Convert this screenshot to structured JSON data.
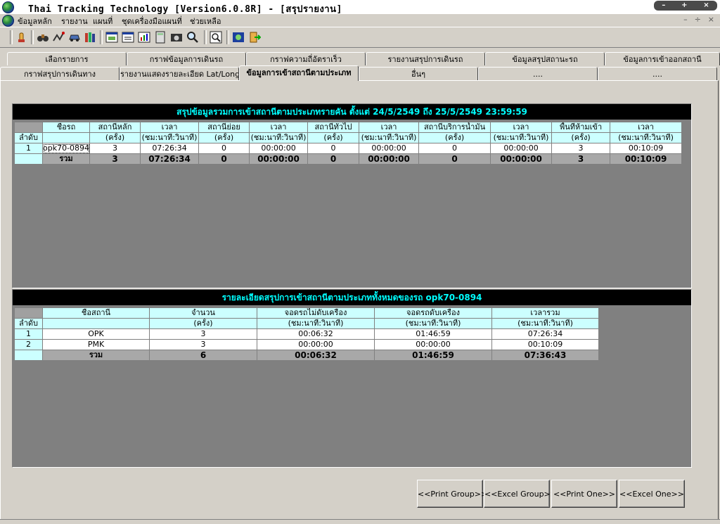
{
  "window": {
    "title": "Thai Tracking Technology [Version6.0.8R] - [สรุปรายงาน]"
  },
  "menu": {
    "items": [
      "ข้อมูลหลัก",
      "รายงาน",
      "แผนที่",
      "ชุดเครื่องมือแผนที่",
      "ช่วยเหลือ"
    ],
    "mdi_controls": [
      "–",
      "÷",
      "×"
    ]
  },
  "toolbar": {
    "icons": [
      "hand-icon",
      "binoculars-icon",
      "route-icon",
      "vehicle-icon",
      "books-icon",
      "map-window-icon",
      "list-window-icon",
      "chart-icon",
      "calculator-icon",
      "camera-icon",
      "search-icon",
      "zoom-icon",
      "export-icon",
      "exit-icon"
    ]
  },
  "tabs": {
    "row1": [
      "เลือกรายการ",
      "กราฟข้อมูลการเดินรถ",
      "กราฟความถี่อัตราเร็ว",
      "รายงานสรุปการเดินรถ",
      "ข้อมูลสรุปสถานะรถ",
      "ข้อมูลการเข้าออกสถานี"
    ],
    "row2": [
      "กราฟสรุปการเดินทาง",
      "รายงานแสดงรายละเอียด Lat/Long",
      "ข้อมูลการเข้าสถานีตามประเภท",
      "อื่นๆ",
      "....",
      "...."
    ],
    "active_index": 2
  },
  "summary": {
    "title": "สรุปข้อมูลรวมการเข้าสถานีตามประเภทรายคัน ตั้งแต่ 24/5/2549  ถึง  25/5/2549 23:59:59",
    "header_row1": [
      "ชื่อรถ",
      "สถานีหลัก",
      "เวลา",
      "สถานีย่อย",
      "เวลา",
      "สถานีทั่วไป",
      "เวลา",
      "สถานีบริการน้ำมัน",
      "เวลา",
      "พื้นที่ห้ามเข้า",
      "เวลา"
    ],
    "header_row2": [
      "",
      "(ครั้ง)",
      "(ชม:นาที:วินาที)",
      "(ครั้ง)",
      "(ชม:นาที:วินาที)",
      "(ครั้ง)",
      "(ชม:นาที:วินาที)",
      "(ครั้ง)",
      "(ชม:นาที:วินาที)",
      "(ครั้ง)",
      "(ชม:นาที:วินาที)"
    ],
    "row_label_header": "ลำดับ",
    "rows": [
      {
        "no": "1",
        "cells": [
          "opk70-0894",
          "3",
          "07:26:34",
          "0",
          "00:00:00",
          "0",
          "00:00:00",
          "0",
          "00:00:00",
          "3",
          "00:10:09"
        ]
      }
    ],
    "total": [
      "รวม",
      "3",
      "07:26:34",
      "0",
      "00:00:00",
      "0",
      "00:00:00",
      "0",
      "00:00:00",
      "3",
      "00:10:09"
    ]
  },
  "detail": {
    "title": "รายละเอียดสรุปการเข้าสถานีตามประเภททั้งหมดของรถ  opk70-0894",
    "header_row1": [
      "ชื่อสถานี",
      "จำนวน",
      "จอดรถไม่ดับเครื่อง",
      "จอดรถดับเครื่อง",
      "เวลารวม"
    ],
    "header_row2": [
      "",
      "(ครั้ง)",
      "(ชม:นาที:วินาที)",
      "(ชม:นาที:วินาที)",
      "(ชม:นาที:วินาที)"
    ],
    "row_label_header": "ลำดับ",
    "rows": [
      {
        "no": "1",
        "cells": [
          "OPK",
          "3",
          "00:06:32",
          "01:46:59",
          "07:26:34"
        ]
      },
      {
        "no": "2",
        "cells": [
          "PMK",
          "3",
          "00:00:00",
          "00:00:00",
          "00:10:09"
        ]
      }
    ],
    "total": [
      "รวม",
      "6",
      "00:06:32",
      "01:46:59",
      "07:36:43"
    ]
  },
  "buttons": {
    "print_group": "<<Print Group>>",
    "excel_group": "<<Excel Group>>",
    "print_one": "<<Print One>>",
    "excel_one": "<<Excel One>>"
  }
}
